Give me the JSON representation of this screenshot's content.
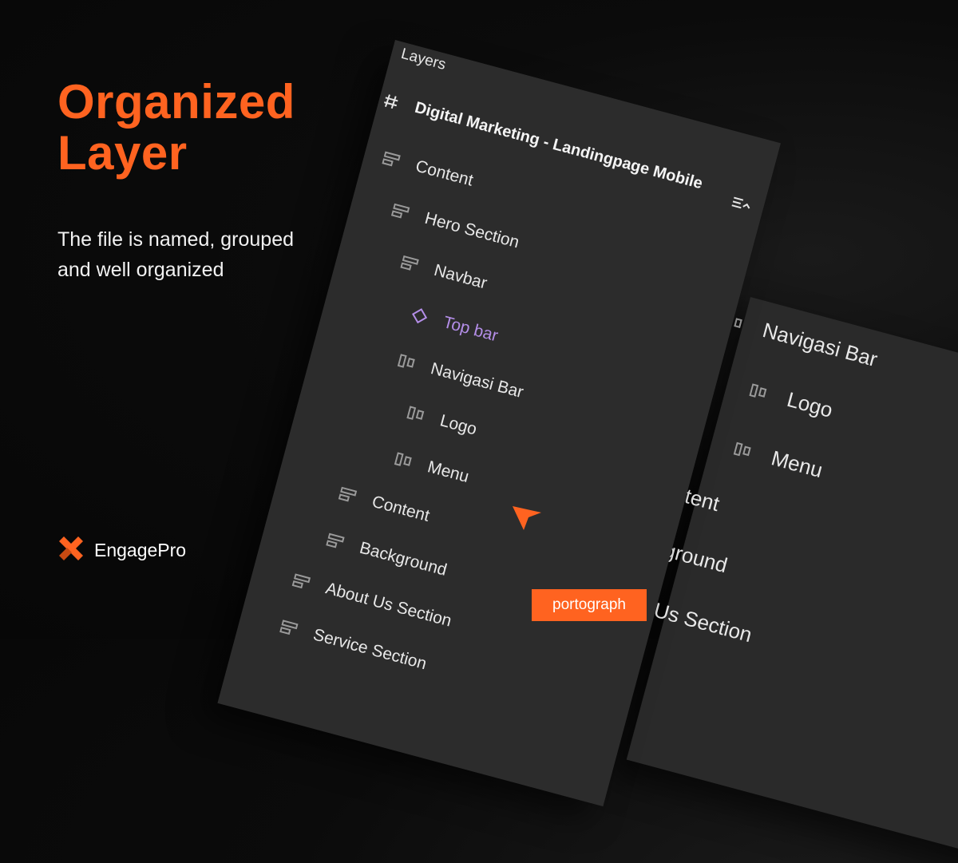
{
  "hero": {
    "title_line1": "Organized",
    "title_line2": "Layer",
    "subtitle": "The file is named, grouped and well organized"
  },
  "brand": {
    "name": "EngagePro",
    "icon": "engagepro-logo-icon",
    "color": "#ff6320"
  },
  "layers_panel": {
    "title": "Layers",
    "frame_name": "Digital Marketing - Landingpage Mobile",
    "frame_icon": "frame-hash-icon",
    "collapse_icon": "collapse-layers-icon",
    "items": [
      {
        "label": "Content",
        "icon": "auto-layout-vertical-icon",
        "depth": 1
      },
      {
        "label": "Hero Section",
        "icon": "auto-layout-vertical-icon",
        "depth": 2
      },
      {
        "label": "Navbar",
        "icon": "auto-layout-vertical-icon",
        "depth": 3
      },
      {
        "label": "Top bar",
        "icon": "component-instance-icon",
        "depth": 4,
        "selected": true
      },
      {
        "label": "Navigasi Bar",
        "icon": "auto-layout-horizontal-icon",
        "depth": 4
      },
      {
        "label": "Logo",
        "icon": "auto-layout-horizontal-icon",
        "depth": 5
      },
      {
        "label": "Menu",
        "icon": "auto-layout-horizontal-icon",
        "depth": 5
      },
      {
        "label": "Content",
        "icon": "auto-layout-vertical-icon",
        "depth": 3
      },
      {
        "label": "Background",
        "icon": "auto-layout-vertical-icon",
        "depth": 3
      },
      {
        "label": "About Us Section",
        "icon": "auto-layout-vertical-icon",
        "depth": 2
      },
      {
        "label": "Service Section",
        "icon": "auto-layout-vertical-icon",
        "depth": 2
      }
    ]
  },
  "zoom_panel": {
    "items": [
      {
        "label": "Navigasi Bar",
        "icon": "auto-layout-horizontal-icon"
      },
      {
        "label": "Logo",
        "icon": "auto-layout-horizontal-icon"
      },
      {
        "label": "Menu",
        "icon": "auto-layout-horizontal-icon"
      },
      {
        "label": "Content",
        "icon": ""
      },
      {
        "label": "Background",
        "icon": ""
      },
      {
        "label": "About Us Section",
        "icon": ""
      }
    ]
  },
  "cursor": {
    "label": "portograph",
    "color": "#ff6320"
  },
  "colors": {
    "accent": "#ff6320",
    "selected": "#b48ee8",
    "panel_bg": "#2c2c2c",
    "page_bg": "#0b0b0b"
  }
}
